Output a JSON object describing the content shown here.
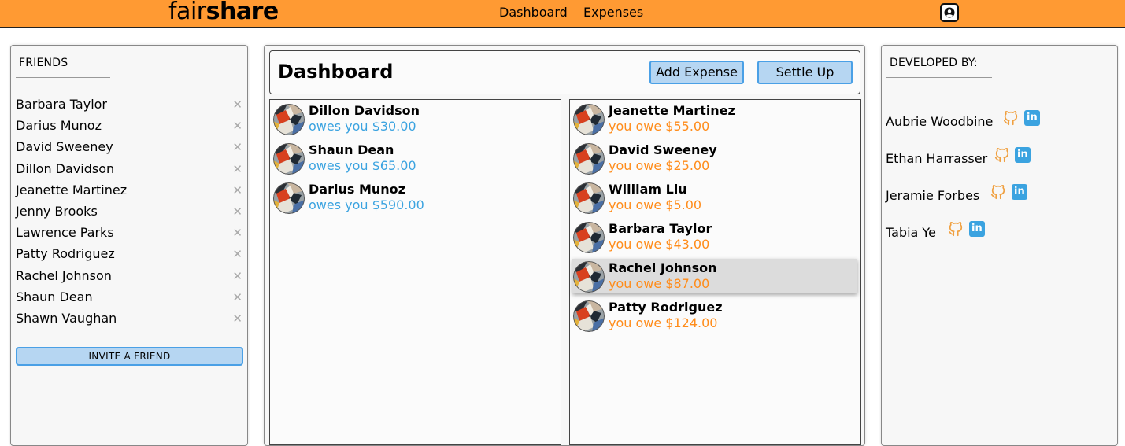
{
  "header": {
    "logo_thin": "fair",
    "logo_bold": "share",
    "nav": [
      "Dashboard",
      "Expenses"
    ],
    "user_icon": "user-circle-icon",
    "bg_color": "#ff9a33"
  },
  "friends": {
    "title": "FRIENDS",
    "items": [
      "Barbara Taylor",
      "Darius Munoz",
      "David Sweeney",
      "Dillon Davidson",
      "Jeanette Martinez",
      "Jenny Brooks",
      "Lawrence Parks",
      "Patty Rodriguez",
      "Rachel Johnson",
      "Shaun Dean",
      "Shawn Vaughan"
    ],
    "remove_glyph": "✕",
    "invite_label": "INVITE A FRIEND"
  },
  "dashboard": {
    "title": "Dashboard",
    "add_expense_label": "Add Expense",
    "settle_up_label": "Settle Up",
    "owes_you": [
      {
        "name": "Dillon Davidson",
        "text": "owes you $30.00"
      },
      {
        "name": "Shaun Dean",
        "text": "owes you $65.00"
      },
      {
        "name": "Darius Munoz",
        "text": "owes you $590.00"
      }
    ],
    "you_owe": [
      {
        "name": "Jeanette Martinez",
        "text": "you owe $55.00"
      },
      {
        "name": "David Sweeney",
        "text": "you owe $25.00"
      },
      {
        "name": "William Liu",
        "text": "you owe $5.00"
      },
      {
        "name": "Barbara Taylor",
        "text": "you owe $43.00"
      },
      {
        "name": "Rachel Johnson",
        "text": "you owe $87.00"
      },
      {
        "name": "Patty Rodriguez",
        "text": "you owe $124.00"
      }
    ],
    "owes_you_color": "#3ba3e0",
    "you_owe_color": "#ff8c1a"
  },
  "developers": {
    "title": "DEVELOPED BY:",
    "items": [
      "Aubrie Woodbine",
      "Ethan Harrasser",
      "Jeramie Forbes",
      "Tabia Ye"
    ],
    "github_icon": "github-icon",
    "linkedin_icon": "linkedin-icon",
    "linkedin_glyph": "in"
  }
}
